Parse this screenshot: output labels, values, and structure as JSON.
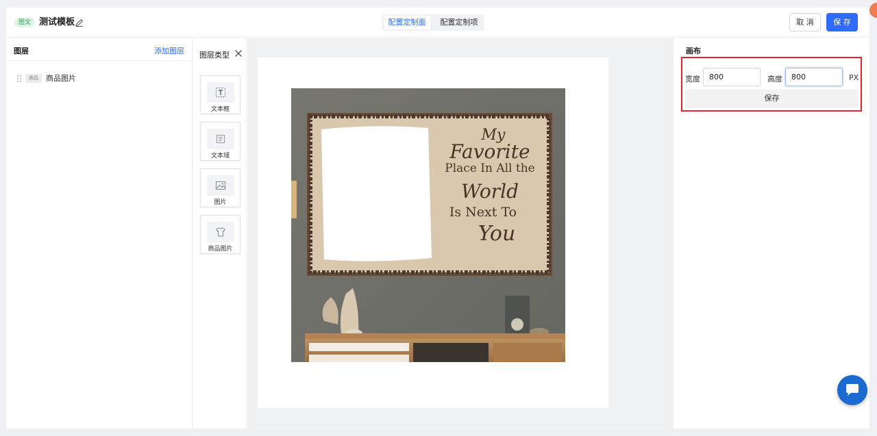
{
  "header": {
    "tag": "图文",
    "template_name": "测试模板",
    "tabs": [
      {
        "label": "配置定制面",
        "active": true
      },
      {
        "label": "配置定制项",
        "active": false
      }
    ],
    "cancel_label": "取 消",
    "save_label": "保 存"
  },
  "layers": {
    "title": "图层",
    "add_label": "添加图层",
    "items": [
      {
        "badge": "商品",
        "name": "商品图片"
      }
    ]
  },
  "layer_types": {
    "title": "图层类型",
    "items": [
      {
        "label": "文本框",
        "icon": "text-box-icon"
      },
      {
        "label": "文本域",
        "icon": "text-area-icon"
      },
      {
        "label": "图片",
        "icon": "image-icon"
      },
      {
        "label": "商品图片",
        "icon": "tshirt-icon"
      }
    ]
  },
  "canvas": {
    "artwork_text": [
      "My",
      "Favorite",
      "Place In All the",
      "World",
      "Is Next To",
      "You"
    ]
  },
  "config": {
    "title": "画布",
    "width_label": "宽度",
    "width_value": "800",
    "height_label": "高度",
    "height_value": "800",
    "unit": "PX",
    "save_label": "保存"
  },
  "colors": {
    "primary": "#2f6bff",
    "highlight": "#e1262c",
    "tag_bg": "#def5e6",
    "tag_text": "#2f9e57",
    "chat": "#1a6ad0"
  }
}
